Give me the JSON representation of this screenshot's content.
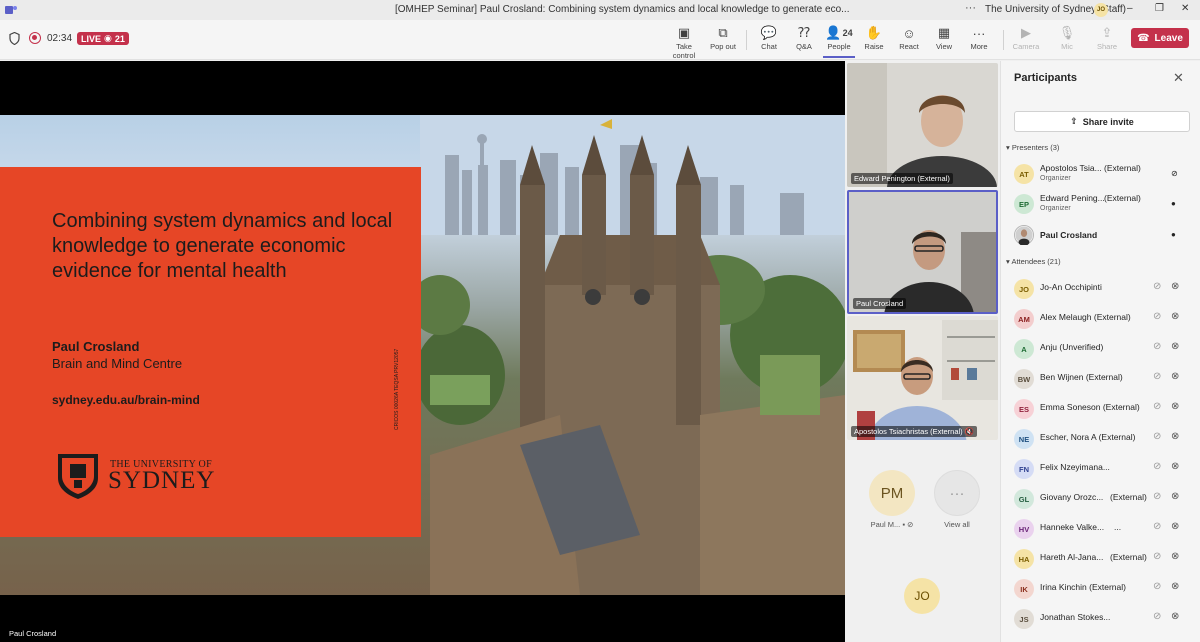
{
  "titlebar": {
    "window_title": "[OMHEP Seminar] Paul Crosland: Combining system dynamics and local knowledge to generate eco...",
    "more": "···",
    "org": "The University of Sydney (Staff)",
    "avatar": "JO",
    "minimize": "–",
    "restore": "❐",
    "close": "✕"
  },
  "meeting": {
    "timer": "02:34",
    "live_label": "LIVE",
    "viewer_count": "21",
    "people_count": "24",
    "tools": [
      {
        "label": "Take control",
        "icon": "take-control-icon",
        "glyph": "▣"
      },
      {
        "label": "Pop out",
        "icon": "pop-out-icon",
        "glyph": "⧉"
      },
      {
        "label": "Chat",
        "icon": "chat-icon",
        "glyph": "💬"
      },
      {
        "label": "Q&A",
        "icon": "qa-icon",
        "glyph": "⁇"
      },
      {
        "label": "People",
        "icon": "people-icon",
        "glyph": "👤"
      },
      {
        "label": "Raise",
        "icon": "raise-hand-icon",
        "glyph": "✋"
      },
      {
        "label": "React",
        "icon": "react-icon",
        "glyph": "☺"
      },
      {
        "label": "View",
        "icon": "view-icon",
        "glyph": "▦"
      },
      {
        "label": "More",
        "icon": "more-icon",
        "glyph": "···"
      },
      {
        "label": "Camera",
        "icon": "camera-icon",
        "glyph": "▶"
      },
      {
        "label": "Mic",
        "icon": "mic-icon",
        "glyph": "🎙"
      },
      {
        "label": "Share",
        "icon": "share-icon",
        "glyph": "⇪"
      }
    ],
    "leave_label": "Leave",
    "accent": "#5b5fc7",
    "leave_color": "#c4314b"
  },
  "slide": {
    "title": "Combining system dynamics and local knowledge to generate economic evidence for mental health",
    "presenter_name": "Paul Crosland",
    "presenter_org": "Brain and Mind Centre",
    "url": "sydney.edu.au/brain-mind",
    "logo_small": "THE UNIVERSITY OF",
    "logo_big": "SYDNEY",
    "cricos": "CRICOS 00026A   TEQSA PRV12057",
    "background_color": "#e64626",
    "shared_by": "Paul Crosland"
  },
  "videos": [
    {
      "name": "Edward Penington (External)"
    },
    {
      "name": "Paul Crosland"
    },
    {
      "name": "Apostolos Tsiachristas (External)"
    }
  ],
  "mini_tiles": {
    "pm_initials": "PM",
    "pm_name": "Paul M...",
    "view_all": "View all",
    "view_all_glyph": "···",
    "jo_initials": "JO"
  },
  "panel": {
    "title": "Participants",
    "share_invite": "Share invite",
    "presenters_label": "Presenters (3)",
    "attendees_label": "Attendees (21)",
    "presenters": [
      {
        "initials": "AT",
        "name": "Apostolos Tsia...",
        "ext": "(External)",
        "role": "Organizer",
        "bg": "#f5e3a6",
        "fg": "#7a5d00"
      },
      {
        "initials": "EP",
        "name": "Edward Pening...",
        "ext": "(External)",
        "role": "Organizer",
        "bg": "#cde8d4",
        "fg": "#1d6b33"
      },
      {
        "initials": "",
        "name": "Paul Crosland",
        "ext": "",
        "role": "",
        "bg": "#ffffff",
        "fg": "#333"
      }
    ],
    "attendees": [
      {
        "initials": "JO",
        "name": "Jo-An Occhipinti",
        "ext": "",
        "bg": "#f5e3a6",
        "fg": "#7a5d00"
      },
      {
        "initials": "AM",
        "name": "Alex Melaugh (External)",
        "ext": "",
        "bg": "#f3cdcd",
        "fg": "#8a1c1c"
      },
      {
        "initials": "A",
        "name": "Anju (Unverified)",
        "ext": "",
        "bg": "#cde8d4",
        "fg": "#1d6b33"
      },
      {
        "initials": "BW",
        "name": "Ben Wijnen (External)",
        "ext": "",
        "bg": "#e1dcd5",
        "fg": "#5a4e3e"
      },
      {
        "initials": "ES",
        "name": "Emma Soneson (External)",
        "ext": "",
        "bg": "#f7d1d6",
        "fg": "#8f1f3a"
      },
      {
        "initials": "NE",
        "name": "Escher, Nora A (External)",
        "ext": "",
        "bg": "#cfe2f3",
        "fg": "#1e4f80"
      },
      {
        "initials": "FN",
        "name": "Felix Nzeyimana...",
        "ext": "",
        "bg": "#d5dcf5",
        "fg": "#2d3f8f"
      },
      {
        "initials": "GL",
        "name": "Giovany Orozc...",
        "ext": "(External)",
        "bg": "#d2e8dc",
        "fg": "#225c3e"
      },
      {
        "initials": "HV",
        "name": "Hanneke Valke...",
        "ext": "...",
        "bg": "#ead2ee",
        "fg": "#6a2277"
      },
      {
        "initials": "HA",
        "name": "Hareth Al-Jana...",
        "ext": "(External)",
        "bg": "#f5e3a6",
        "fg": "#7a5d00"
      },
      {
        "initials": "IK",
        "name": "Irina Kinchin (External)",
        "ext": "",
        "bg": "#f3d6cf",
        "fg": "#8a2e1c"
      },
      {
        "initials": "JS",
        "name": "Jonathan Stokes...",
        "ext": "",
        "bg": "#e1dcd5",
        "fg": "#5a4e3e"
      }
    ],
    "muted_glyph": "🚫",
    "mic_glyph": "🎤",
    "video_off_glyph": "⊘",
    "mic_off_glyph": "⊗"
  }
}
